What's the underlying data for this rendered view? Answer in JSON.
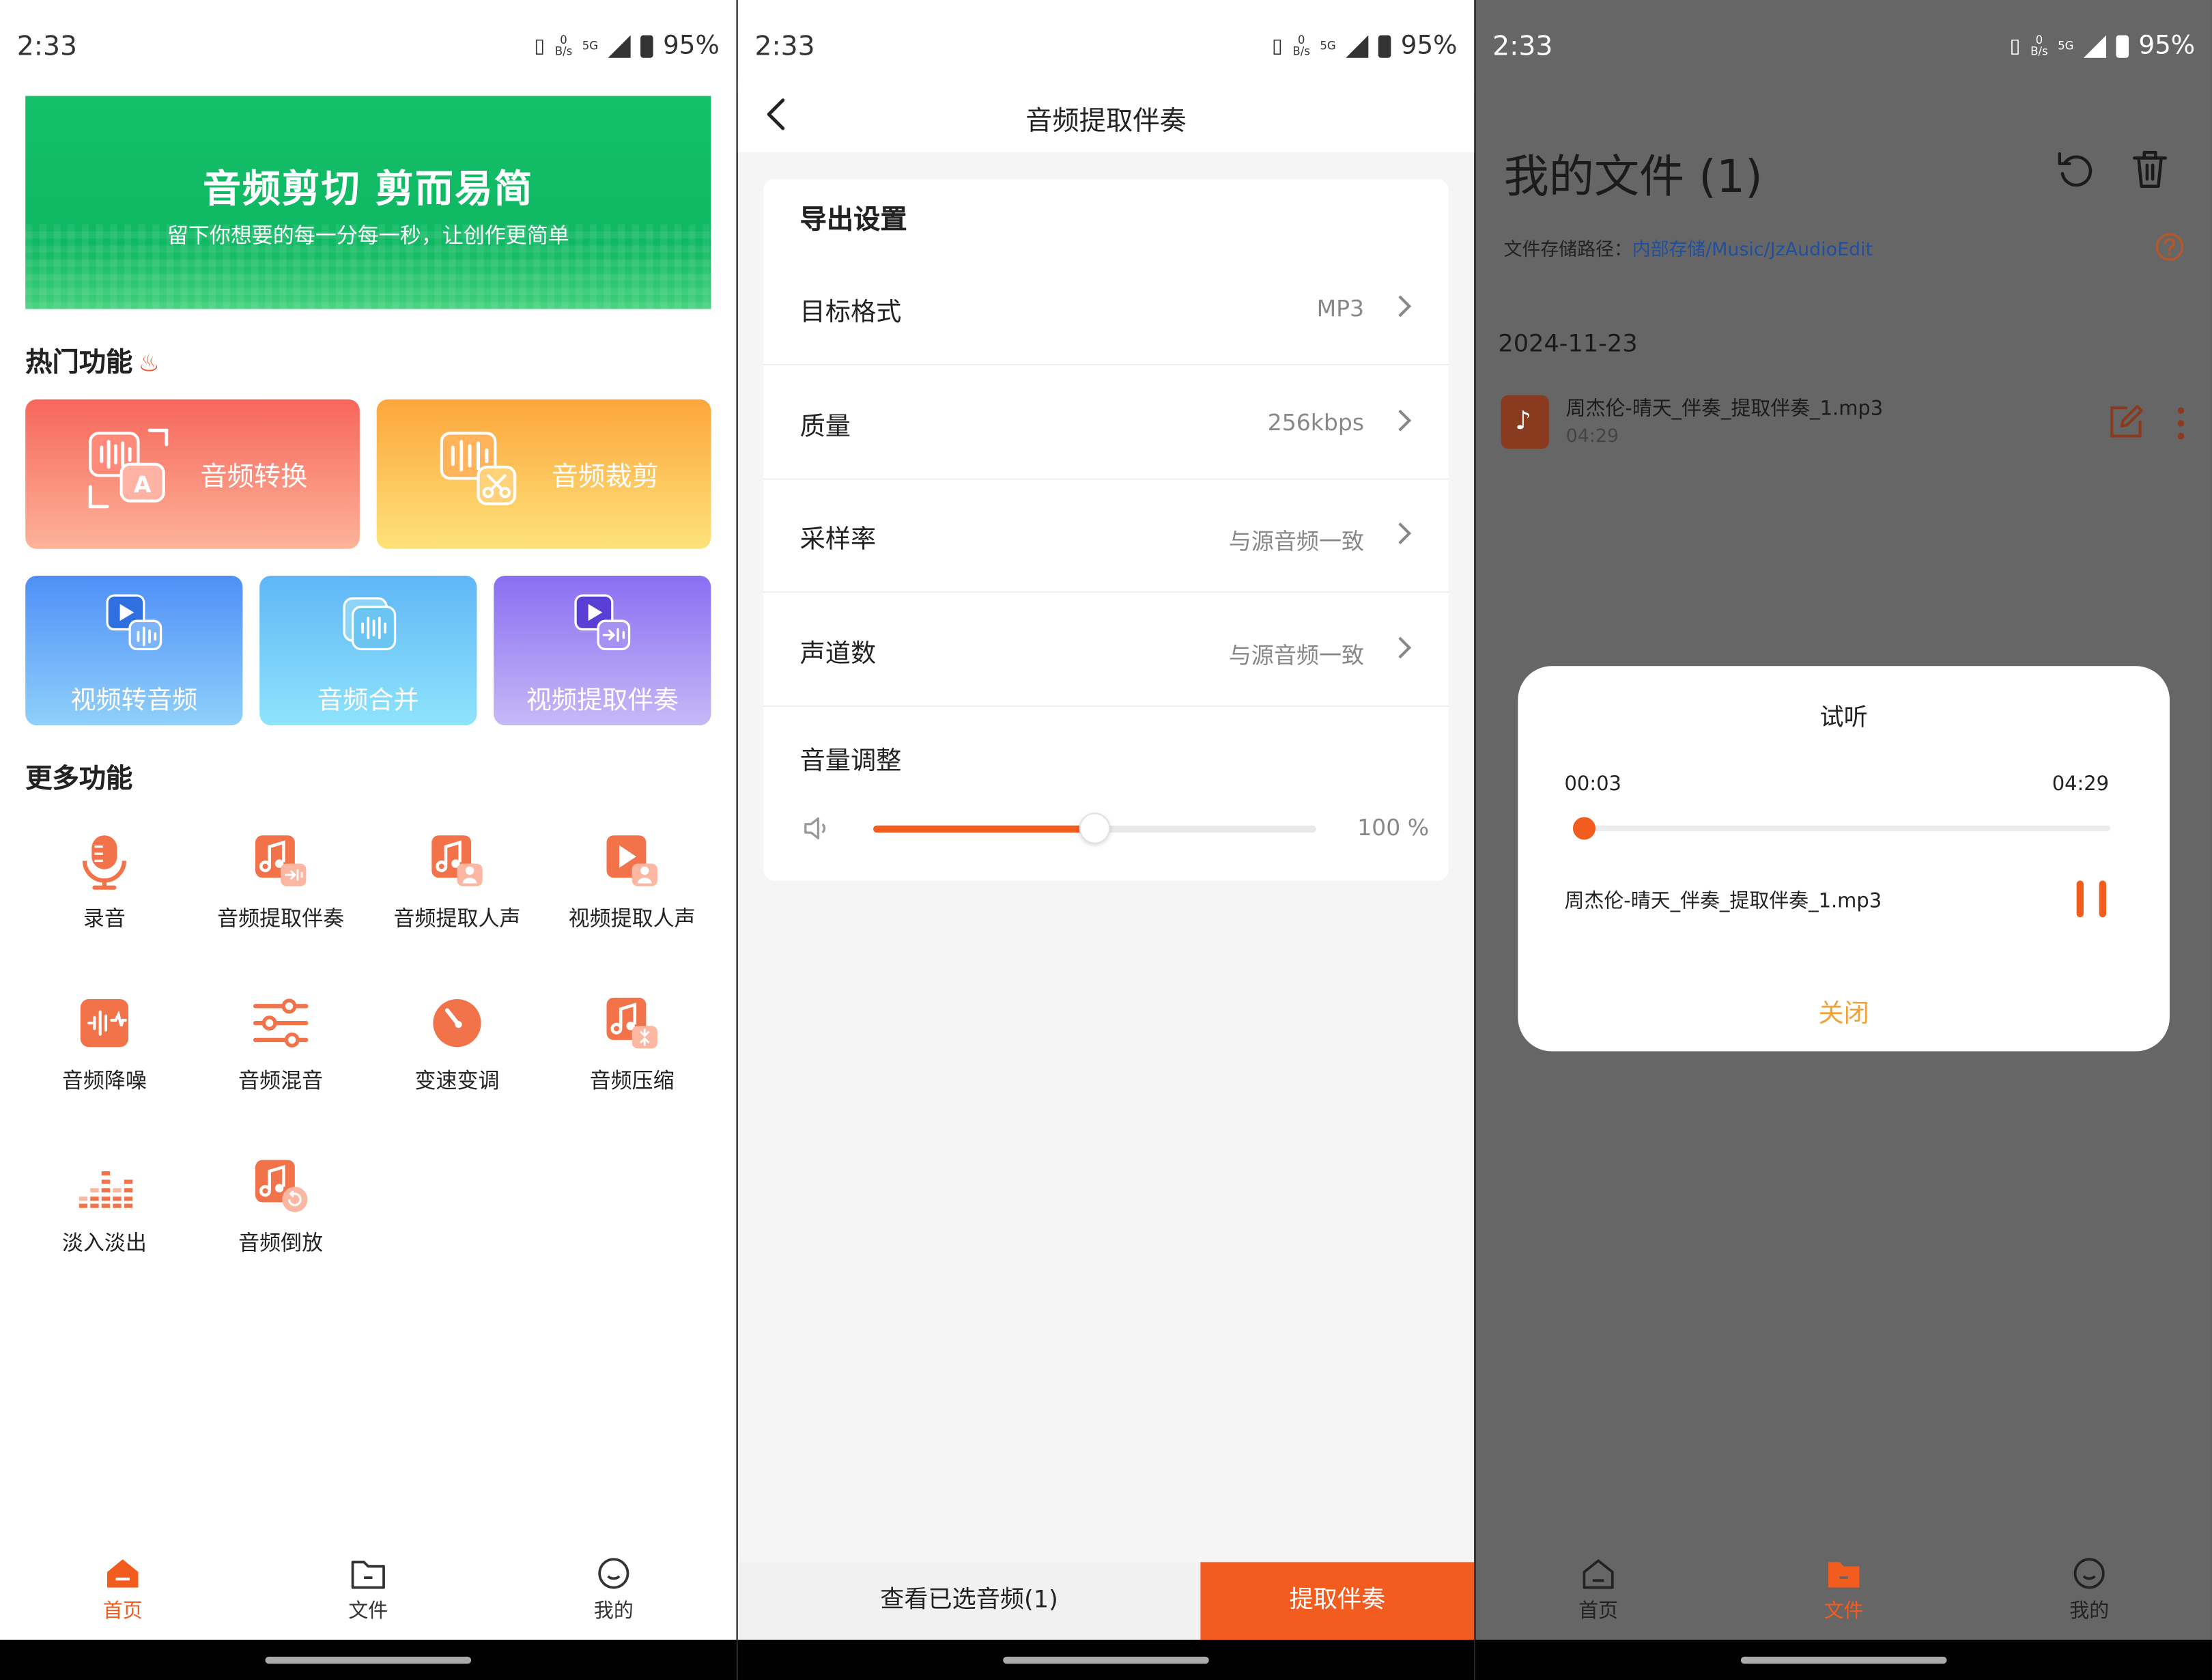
{
  "status": {
    "time": "2:33",
    "net_rate": "0\nB/s",
    "net_type": "5G",
    "battery": "95%"
  },
  "colors": {
    "accent": "#f25c1f",
    "green_banner": "#14c06a",
    "close_text": "#f0a23a"
  },
  "home": {
    "banner": {
      "title": "音频剪切 剪而易简",
      "subtitle": "留下你想要的每一分每一秒，让创作更简单"
    },
    "hot_title": "热门功能",
    "hot": [
      {
        "label": "音频转换",
        "icon": "audio-convert-icon"
      },
      {
        "label": "音频裁剪",
        "icon": "audio-cut-icon"
      },
      {
        "label": "视频转音频",
        "icon": "video-to-audio-icon"
      },
      {
        "label": "音频合并",
        "icon": "audio-merge-icon"
      },
      {
        "label": "视频提取伴奏",
        "icon": "video-extract-accompaniment-icon"
      }
    ],
    "more_title": "更多功能",
    "more": [
      {
        "label": "录音",
        "icon": "microphone-icon"
      },
      {
        "label": "音频提取伴奏",
        "icon": "audio-extract-accompaniment-icon"
      },
      {
        "label": "音频提取人声",
        "icon": "audio-extract-vocal-icon"
      },
      {
        "label": "视频提取人声",
        "icon": "video-extract-vocal-icon"
      },
      {
        "label": "音频降噪",
        "icon": "noise-reduction-icon"
      },
      {
        "label": "音频混音",
        "icon": "mixer-icon"
      },
      {
        "label": "变速变调",
        "icon": "speed-pitch-icon"
      },
      {
        "label": "音频压缩",
        "icon": "audio-compress-icon"
      },
      {
        "label": "淡入淡出",
        "icon": "fade-icon"
      },
      {
        "label": "音频倒放",
        "icon": "audio-reverse-icon"
      }
    ]
  },
  "tabs": [
    {
      "label": "首页",
      "icon": "home-icon"
    },
    {
      "label": "文件",
      "icon": "folder-icon"
    },
    {
      "label": "我的",
      "icon": "profile-icon"
    }
  ],
  "extract": {
    "title": "音频提取伴奏",
    "section": "导出设置",
    "rows": [
      {
        "key": "目标格式",
        "value": "MP3"
      },
      {
        "key": "质量",
        "value": "256kbps"
      },
      {
        "key": "采样率",
        "value": "与源音频一致"
      },
      {
        "key": "声道数",
        "value": "与源音频一致"
      }
    ],
    "volume_title": "音量调整",
    "volume_value": "100 %",
    "volume_level": 0.5,
    "view_selected": "查看已选音频(1)",
    "submit": "提取伴奏"
  },
  "files": {
    "title": "我的文件 (1)",
    "path_label": "文件存储路径：",
    "path_value": "内部存储/Music/JzAudioEdit",
    "date": "2024-11-23",
    "file_name": "周杰伦-晴天_伴奏_提取伴奏_1.mp3",
    "file_duration": "04:29"
  },
  "dialog": {
    "title": "试听",
    "current": "00:03",
    "total": "04:29",
    "progress": 0.012,
    "file_name": "周杰伦-晴天_伴奏_提取伴奏_1.mp3",
    "close": "关闭"
  }
}
